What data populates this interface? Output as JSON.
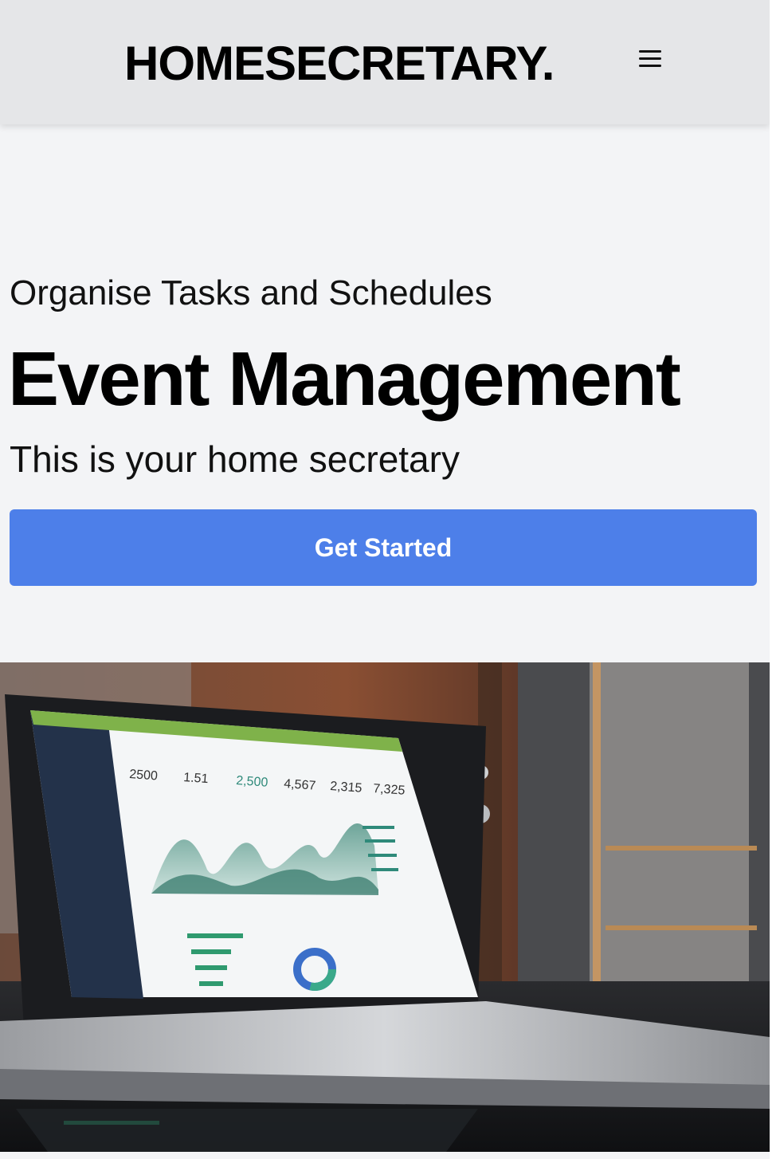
{
  "header": {
    "brand": "HOMESECRETARY.",
    "menu_icon": "hamburger-menu-icon"
  },
  "hero": {
    "eyebrow": "Organise Tasks and Schedules",
    "headline": "Event Management",
    "tagline": "This is your home secretary",
    "cta_label": "Get Started"
  },
  "hero_image": {
    "subject": "laptop-dashboard-photo",
    "screen_stats": [
      "2500",
      "1.51",
      "2,500",
      "4,567",
      "2,315",
      "7,325"
    ]
  },
  "colors": {
    "header_bg": "#e5e6e8",
    "page_bg": "#f3f4f6",
    "accent": "#4d7fe9",
    "text": "#000000"
  }
}
